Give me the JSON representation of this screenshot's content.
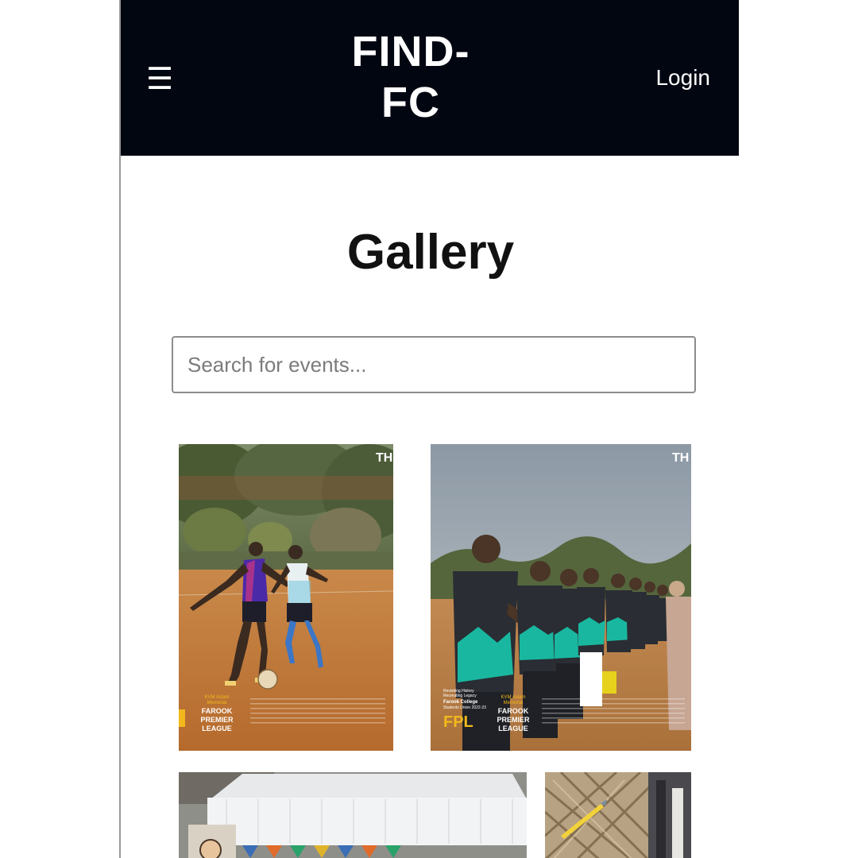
{
  "navbar": {
    "menu_icon": "☰",
    "logo": "FIND-\nFC",
    "login_label": "Login"
  },
  "page": {
    "title": "Gallery"
  },
  "search": {
    "placeholder": "Search for events..."
  },
  "gallery": {
    "cards": [
      {
        "logo_text": "TH",
        "memorial_line1": "KVM Aslam",
        "memorial_line2": "Memorial",
        "league_line1": "FAROOK",
        "league_line2": "PREMIER",
        "league_line3": "LEAGUE"
      },
      {
        "logo_text": "TH",
        "tagline1": "Revisiting History",
        "tagline2": "Recreating Legacy",
        "college": "Farook College",
        "union": "Students Union 2022-23",
        "fpl": "FPL",
        "memorial_line1": "KVM Aslam",
        "memorial_line2": "Memorial",
        "league_line1": "FAROOK",
        "league_line2": "PREMIER",
        "league_line3": "LEAGUE"
      }
    ]
  },
  "colors": {
    "navbar_bg": "#020611",
    "accent_yellow": "#f2b81c"
  }
}
